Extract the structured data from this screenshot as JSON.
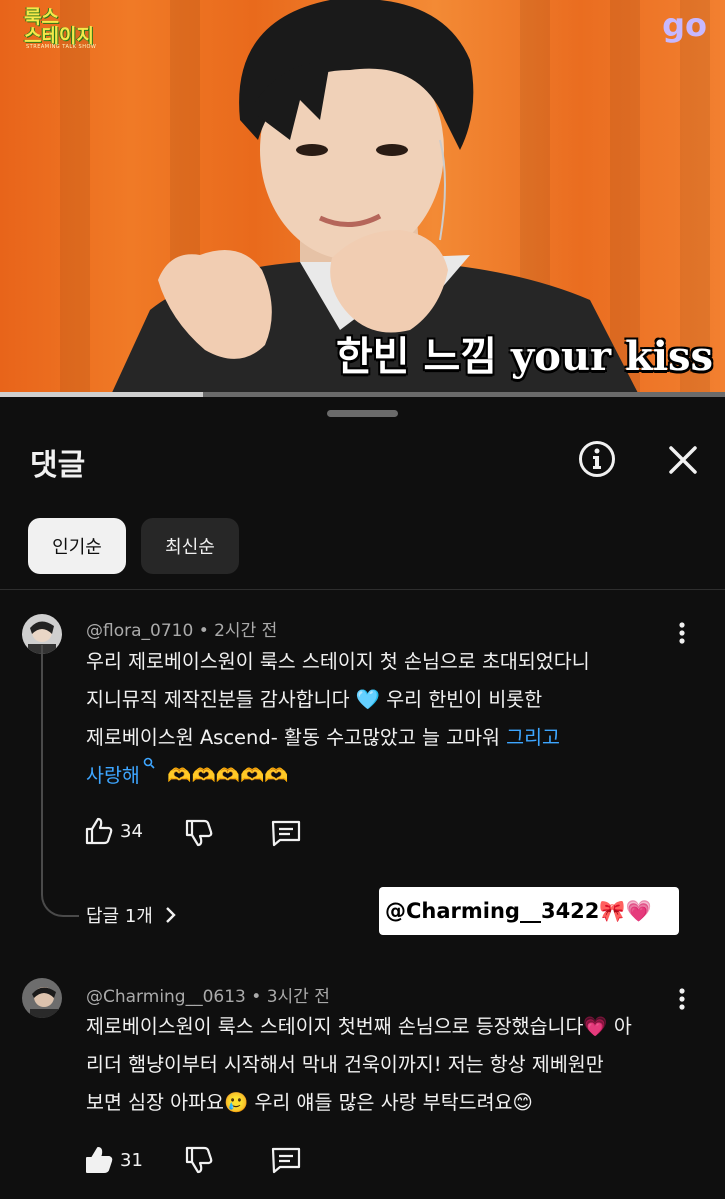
{
  "video": {
    "show_logo_line1": "룩스",
    "show_logo_line2": "스테이지",
    "show_logo_sub": "STREAMING TALK SHOW",
    "channel_mark": "go",
    "subtitle": "한빈 느낌 your kiss",
    "progress_fraction": 0.28
  },
  "sheet": {
    "title": "댓글",
    "filters": {
      "popular": "인기순",
      "newest": "최신순",
      "selected": "popular"
    }
  },
  "comments": [
    {
      "author": "@flora_0710",
      "time": "• 2시간 전",
      "lines": [
        "우리 제로베이스원이 룩스 스테이지 첫 손님으로 초대되었다니",
        "지니뮤직 제작진분들 감사합니다 🩵 우리 한빈이 비롯한",
        "제로베이스원 Ascend- 활동 수고많았고 늘 고마워"
      ],
      "link_text_1": "그리고",
      "link_text_2": "사랑해",
      "tail_emoji": "🫶🫶🫶🫶🫶",
      "likes": "34",
      "replies_label": "답글 1개"
    },
    {
      "author": "@Charming__0613",
      "time": "• 3시간 전",
      "lines": [
        "제로베이스원이 룩스 스테이지 첫번째 손님으로 등장했습니다💗 아",
        "리더 햄냥이부터 시작해서 막내 건욱이까지! 저는 항상 제베원만",
        "보면 심장 아파요🥲 우리 얘들 많은 사랑 부탁드려요😊"
      ],
      "likes": "31"
    }
  ],
  "overlay_sticker": "@Charming__3422🎀💗",
  "colors": {
    "background": "#0f0f0f",
    "link": "#3ea6ff",
    "chip_selected": "#f1f1f1",
    "chip": "#272727"
  }
}
